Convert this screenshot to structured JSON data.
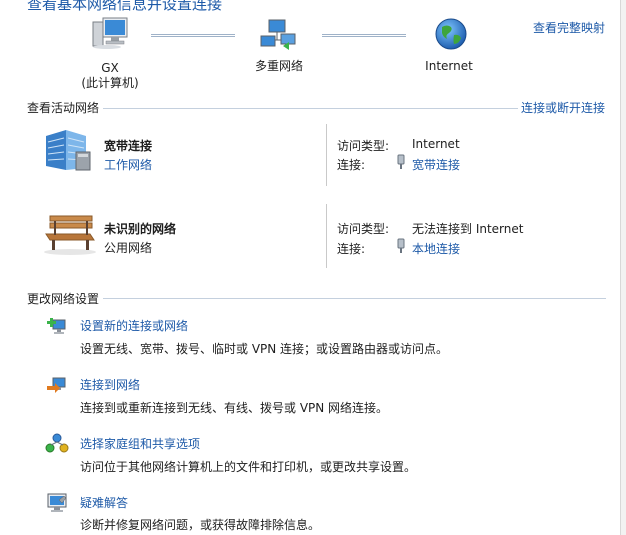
{
  "header": {
    "title": "查看基本网络信息并设置连接",
    "full_map_link": "查看完整映射"
  },
  "map": {
    "computer_name": "GX",
    "computer_sub": "(此计算机)",
    "network_label": "多重网络",
    "internet_label": "Internet"
  },
  "active": {
    "section_label": "查看活动网络",
    "connect_link": "连接或断开连接",
    "networks": [
      {
        "name": "宽带连接",
        "category": "工作网络",
        "access_key": "访问类型:",
        "access_value": "Internet",
        "conn_key": "连接:",
        "conn_value": "宽带连接"
      },
      {
        "name": "未识别的网络",
        "category": "公用网络",
        "access_key": "访问类型:",
        "access_value": "无法连接到 Internet",
        "conn_key": "连接:",
        "conn_value": "本地连接"
      }
    ]
  },
  "change": {
    "section_label": "更改网络设置",
    "tasks": [
      {
        "title": "设置新的连接或网络",
        "desc": "设置无线、宽带、拨号、临时或 VPN 连接；或设置路由器或访问点。"
      },
      {
        "title": "连接到网络",
        "desc": "连接到或重新连接到无线、有线、拨号或 VPN 网络连接。"
      },
      {
        "title": "选择家庭组和共享选项",
        "desc": "访问位于其他网络计算机上的文件和打印机，或更改共享设置。"
      },
      {
        "title": "疑难解答",
        "desc": "诊断并修复网络问题，或获得故障排除信息。"
      }
    ]
  }
}
